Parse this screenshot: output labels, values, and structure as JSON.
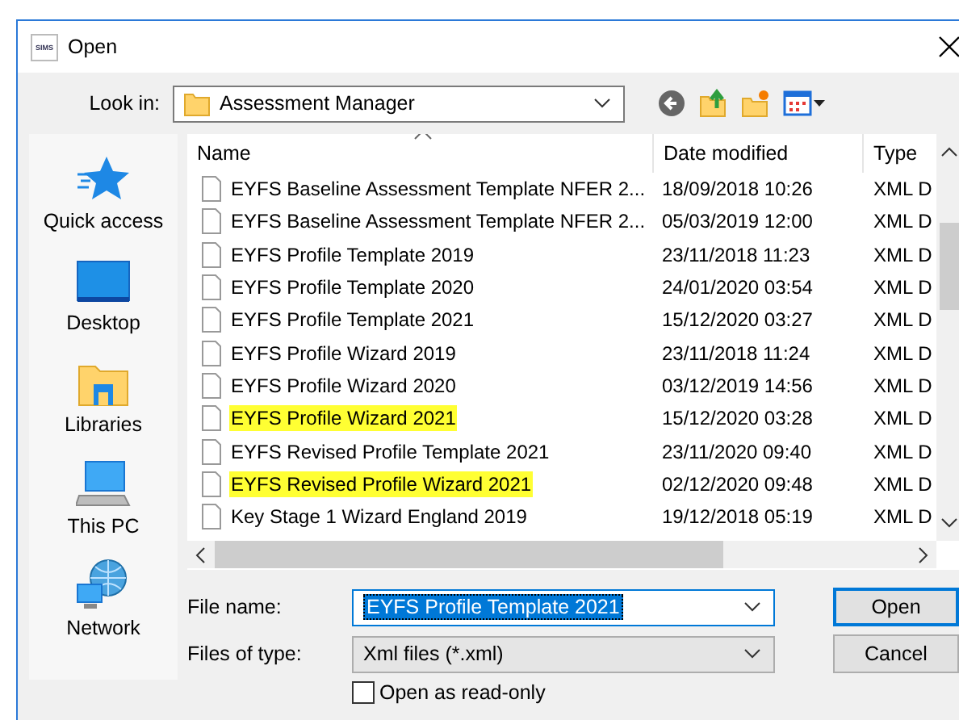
{
  "window": {
    "title": "Open",
    "app_icon_text": "SIMS"
  },
  "look_in": {
    "label": "Look in:",
    "value": "Assessment Manager"
  },
  "sidebar": {
    "items": [
      {
        "kind": "star",
        "label": "Quick access"
      },
      {
        "kind": "desktop",
        "label": "Desktop"
      },
      {
        "kind": "libraries",
        "label": "Libraries"
      },
      {
        "kind": "pc",
        "label": "This PC"
      },
      {
        "kind": "network",
        "label": "Network"
      }
    ]
  },
  "file_list": {
    "columns": [
      "Name",
      "Date modified",
      "Type"
    ],
    "rows": [
      {
        "name": "EYFS Baseline Assessment Template NFER 2...",
        "date": "18/09/2018 10:26",
        "type": "XML D",
        "highlighted": false
      },
      {
        "name": "EYFS Baseline Assessment Template NFER 2...",
        "date": "05/03/2019 12:00",
        "type": "XML D",
        "highlighted": false
      },
      {
        "name": "EYFS Profile Template 2019",
        "date": "23/11/2018 11:23",
        "type": "XML D",
        "highlighted": false
      },
      {
        "name": "EYFS Profile Template 2020",
        "date": "24/01/2020 03:54",
        "type": "XML D",
        "highlighted": false
      },
      {
        "name": "EYFS Profile Template 2021",
        "date": "15/12/2020 03:27",
        "type": "XML D",
        "highlighted": false
      },
      {
        "name": "EYFS Profile Wizard 2019",
        "date": "23/11/2018 11:24",
        "type": "XML D",
        "highlighted": false
      },
      {
        "name": "EYFS Profile Wizard 2020",
        "date": "03/12/2019 14:56",
        "type": "XML D",
        "highlighted": false
      },
      {
        "name": "EYFS Profile Wizard 2021",
        "date": "15/12/2020 03:28",
        "type": "XML D",
        "highlighted": true
      },
      {
        "name": "EYFS Revised Profile Template 2021",
        "date": "23/11/2020 09:40",
        "type": "XML D",
        "highlighted": false
      },
      {
        "name": "EYFS Revised Profile Wizard 2021",
        "date": "02/12/2020 09:48",
        "type": "XML D",
        "highlighted": true
      },
      {
        "name": "Key Stage 1 Wizard England 2019",
        "date": "19/12/2018 05:19",
        "type": "XML D",
        "highlighted": false
      }
    ]
  },
  "file_name": {
    "label": "File name:",
    "value": "EYFS Profile Template 2021"
  },
  "file_type": {
    "label": "Files of type:",
    "value": "Xml files (*.xml)"
  },
  "read_only": {
    "label": "Open as read-only",
    "checked": false
  },
  "buttons": [
    {
      "label": "Open",
      "default": true
    },
    {
      "label": "Cancel",
      "default": false
    }
  ]
}
